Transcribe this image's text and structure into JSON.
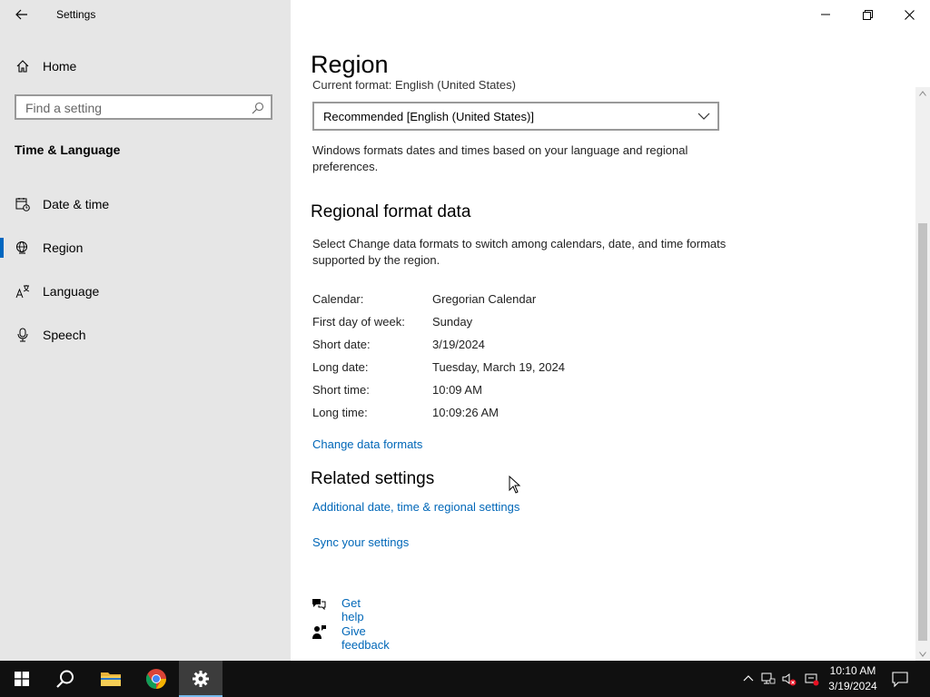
{
  "app": {
    "title": "Settings"
  },
  "sidebar": {
    "home_label": "Home",
    "search_placeholder": "Find a setting",
    "section_title": "Time & Language",
    "items": [
      {
        "label": "Date & time",
        "icon": "calendar-clock-icon"
      },
      {
        "label": "Region",
        "icon": "globe-icon",
        "active": true
      },
      {
        "label": "Language",
        "icon": "language-icon"
      },
      {
        "label": "Speech",
        "icon": "microphone-icon"
      }
    ]
  },
  "main": {
    "page_title": "Region",
    "current_format_label": "Current format: English (United States)",
    "format_dropdown_value": "Recommended [English (United States)]",
    "format_description": "Windows formats dates and times based on your language and regional preferences.",
    "regional_heading": "Regional format data",
    "regional_description": "Select Change data formats to switch among calendars, date, and time formats supported by the region.",
    "format_rows": [
      {
        "label": "Calendar:",
        "value": "Gregorian Calendar"
      },
      {
        "label": "First day of week:",
        "value": "Sunday"
      },
      {
        "label": "Short date:",
        "value": "3/19/2024"
      },
      {
        "label": "Long date:",
        "value": "Tuesday, March 19, 2024"
      },
      {
        "label": "Short time:",
        "value": "10:09 AM"
      },
      {
        "label": "Long time:",
        "value": "10:09:26 AM"
      }
    ],
    "change_formats_link": "Change data formats",
    "related_heading": "Related settings",
    "related_link_1": "Additional date, time & regional settings",
    "related_link_2": "Sync your settings",
    "get_help": "Get help",
    "give_feedback": "Give feedback"
  },
  "taskbar": {
    "time": "10:10 AM",
    "date": "3/19/2024"
  },
  "colors": {
    "accent": "#0067c0",
    "link": "#0067b8",
    "sidebar_bg": "#e6e6e6",
    "taskbar_bg": "#101010"
  }
}
